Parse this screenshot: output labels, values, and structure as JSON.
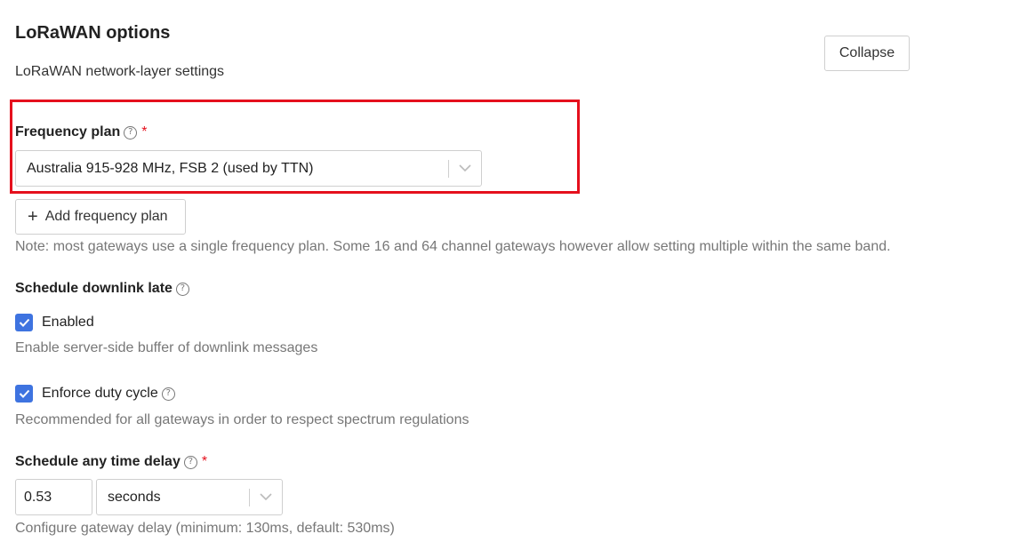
{
  "section": {
    "title": "LoRaWAN options",
    "subtitle": "LoRaWAN network-layer settings",
    "collapse_label": "Collapse"
  },
  "frequency_plan": {
    "label": "Frequency plan",
    "required_mark": "*",
    "selected": "Australia 915-928 MHz, FSB 2 (used by TTN)",
    "add_label": "Add frequency plan",
    "note": "Note: most gateways use a single frequency plan. Some 16 and 64 channel gateways however allow setting multiple within the same band."
  },
  "schedule_downlink_late": {
    "label": "Schedule downlink late",
    "checkbox_label": "Enabled",
    "checked": true,
    "description": "Enable server-side buffer of downlink messages"
  },
  "enforce_duty_cycle": {
    "checkbox_label": "Enforce duty cycle",
    "checked": true,
    "description": "Recommended for all gateways in order to respect spectrum regulations"
  },
  "schedule_any_time_delay": {
    "label": "Schedule any time delay",
    "required_mark": "*",
    "value": "0.53",
    "unit": "seconds",
    "description": "Configure gateway delay (minimum: 130ms, default: 530ms)"
  },
  "icons": {
    "help": "question-circle-icon",
    "chevron": "chevron-down-icon",
    "check": "checkmark-icon",
    "plus": "plus-icon"
  },
  "colors": {
    "highlight": "#e5101d",
    "checkbox": "#3e73e0",
    "required": "#e5101d"
  }
}
